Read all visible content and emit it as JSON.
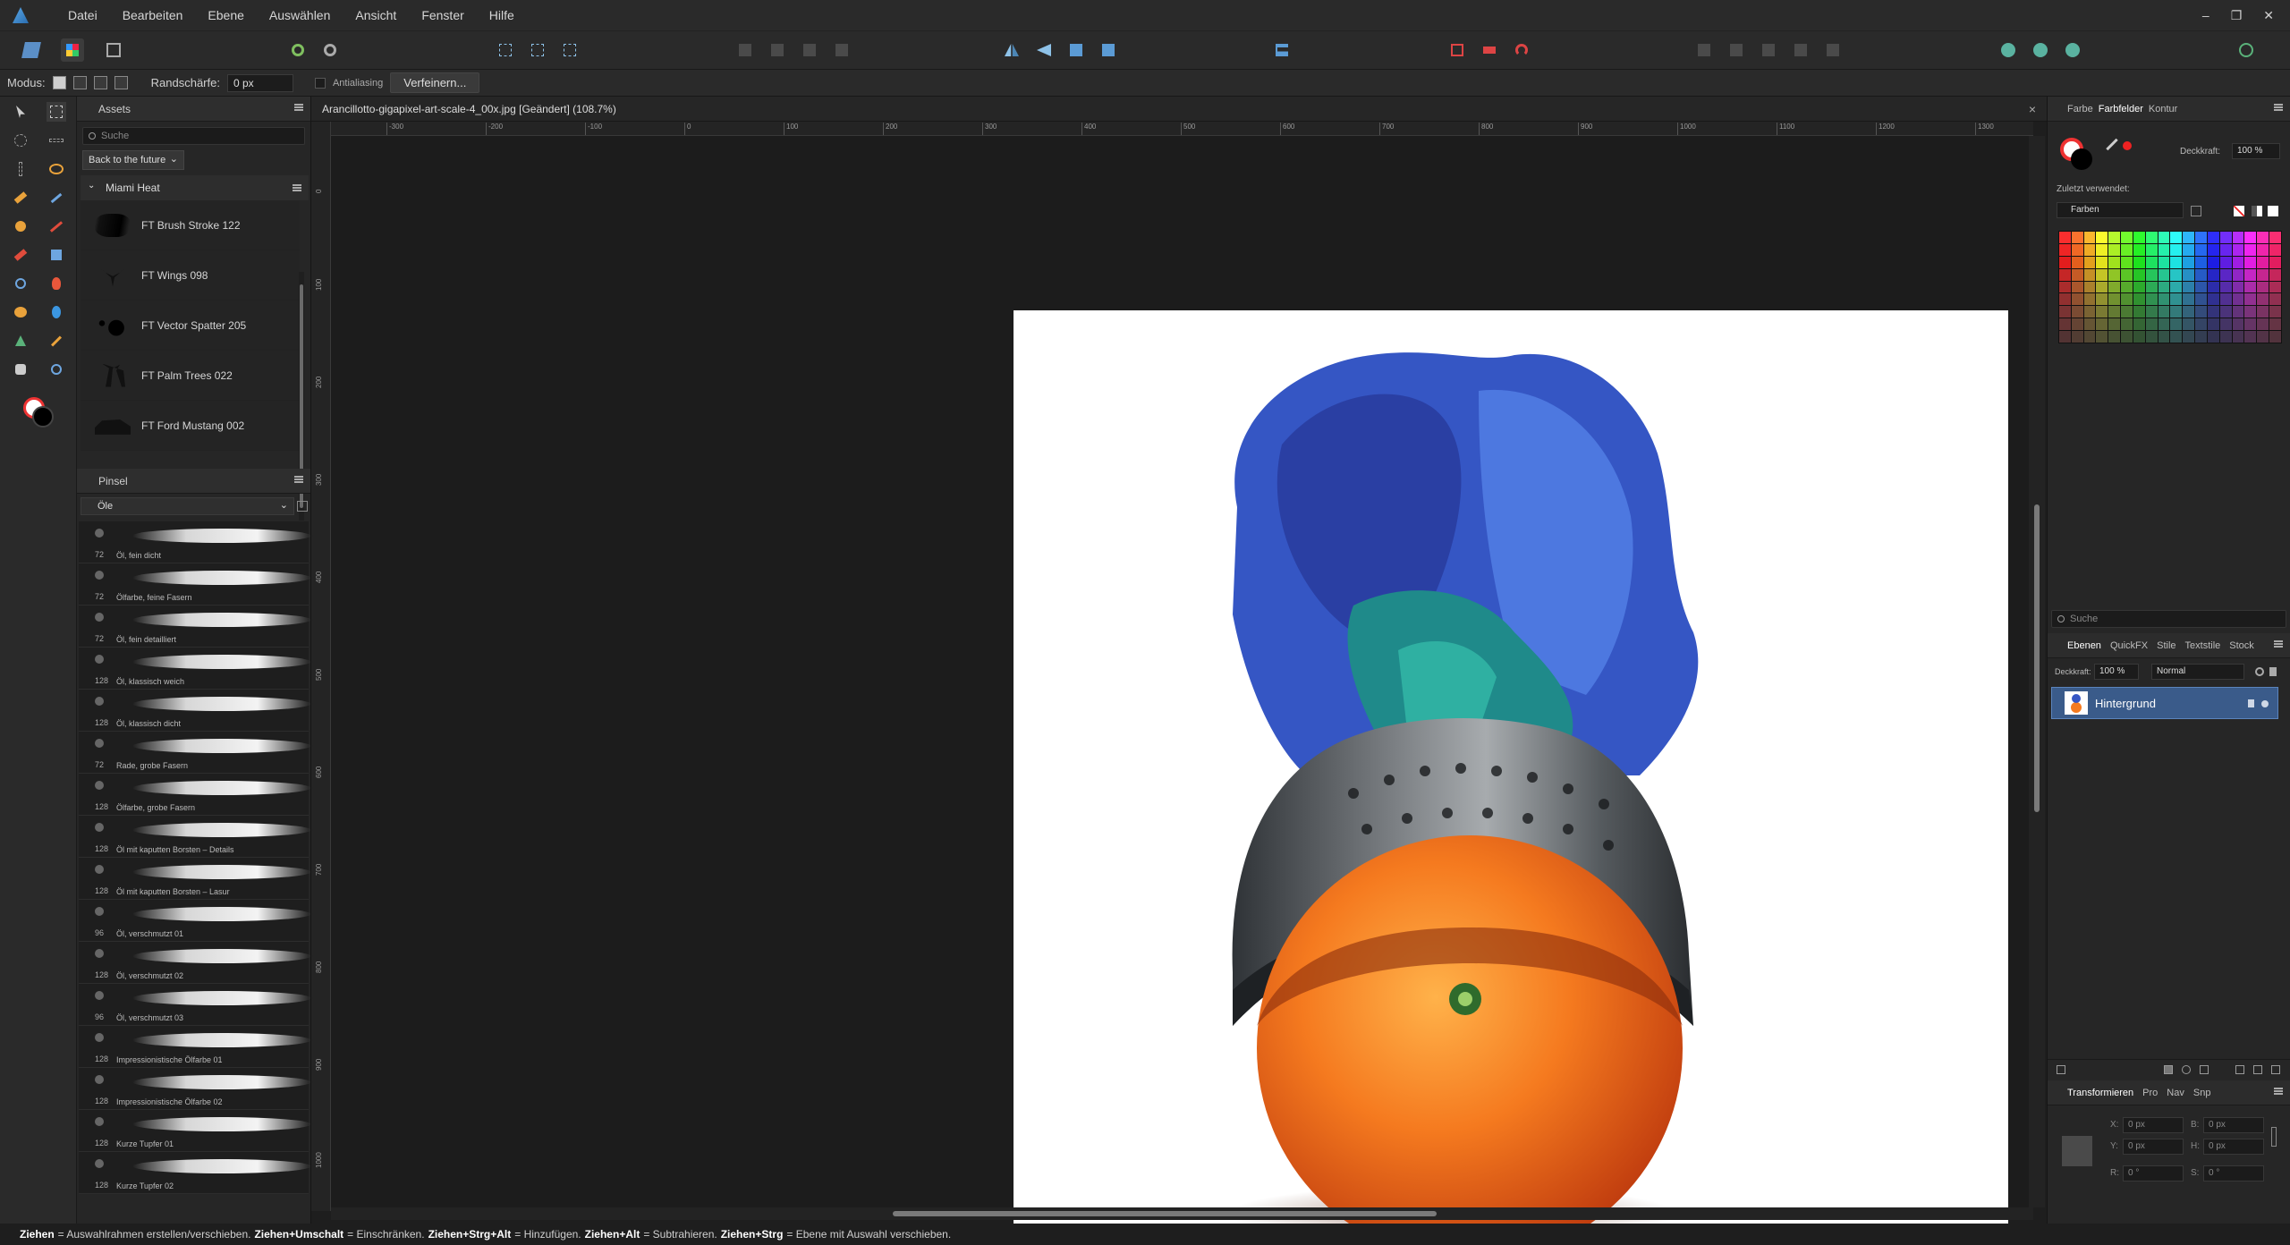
{
  "menu": {
    "items": [
      "Datei",
      "Bearbeiten",
      "Ebene",
      "Auswählen",
      "Ansicht",
      "Fenster",
      "Hilfe"
    ],
    "win_controls": [
      "–",
      "❐",
      "✕"
    ]
  },
  "context": {
    "mode_label": "Modus:",
    "feather_label": "Randschärfe:",
    "feather_value": "0 px",
    "antialias_label": "Antialiasing",
    "refine_button": "Verfeinern..."
  },
  "assets_panel": {
    "tab": "Assets",
    "search_placeholder": "Suche",
    "set_dropdown": "Back to the future",
    "category": "Miami Heat",
    "items": [
      {
        "name": "FT Brush Stroke 122"
      },
      {
        "name": "FT Wings 098"
      },
      {
        "name": "FT Vector Spatter 205"
      },
      {
        "name": "FT Palm Trees 022"
      },
      {
        "name": "FT Ford Mustang 002"
      }
    ]
  },
  "brush_panel": {
    "tab": "Pinsel",
    "category": "Öle",
    "brushes": [
      {
        "size": "72",
        "name": "Öl, fein dicht"
      },
      {
        "size": "72",
        "name": "Ölfarbe, feine Fasern"
      },
      {
        "size": "72",
        "name": "Öl, fein detailliert"
      },
      {
        "size": "128",
        "name": "Öl, klassisch weich"
      },
      {
        "size": "128",
        "name": "Öl, klassisch dicht"
      },
      {
        "size": "72",
        "name": "Rade, grobe Fasern"
      },
      {
        "size": "128",
        "name": "Ölfarbe, grobe Fasern"
      },
      {
        "size": "128",
        "name": "Öl mit kaputten Borsten – Details"
      },
      {
        "size": "128",
        "name": "Öl mit kaputten Borsten – Lasur"
      },
      {
        "size": "96",
        "name": "Öl, verschmutzt 01"
      },
      {
        "size": "128",
        "name": "Öl, verschmutzt 02"
      },
      {
        "size": "96",
        "name": "Öl, verschmutzt 03"
      },
      {
        "size": "128",
        "name": "Impressionistische Ölfarbe 01"
      },
      {
        "size": "128",
        "name": "Impressionistische Ölfarbe 02"
      },
      {
        "size": "128",
        "name": "Kurze Tupfer 01"
      },
      {
        "size": "128",
        "name": "Kurze Tupfer 02"
      }
    ]
  },
  "document": {
    "tab_title": "Arancillotto-gigapixel-art-scale-4_00x.jpg [Geändert] (108.7%)",
    "close": "×",
    "ruler_h_labels": [
      "-300",
      "-200",
      "-100",
      "0",
      "100",
      "200",
      "300",
      "400",
      "500",
      "600",
      "700",
      "800",
      "900",
      "1000",
      "1100",
      "1200",
      "1300"
    ],
    "ruler_v_labels": [
      "0",
      "100",
      "200",
      "300",
      "400",
      "500",
      "600",
      "700",
      "800",
      "900",
      "1000"
    ]
  },
  "colour_panel": {
    "tabs": [
      "Farbe",
      "Farbfelder",
      "Kontur"
    ],
    "opacity_label": "Deckkraft:",
    "opacity_value": "100 %",
    "recent_label": "Zuletzt verwendet:",
    "palette_dropdown": "Farben"
  },
  "layers_panel": {
    "search_placeholder": "Suche",
    "tabs": [
      "Ebenen",
      "QuickFX",
      "Stile",
      "Textstile",
      "Stock"
    ],
    "opacity_label": "Deckkraft:",
    "opacity_value": "100 %",
    "blend_mode": "Normal",
    "layer_name": "Hintergrund"
  },
  "transform_panel": {
    "tabs": [
      "Transformieren",
      "Pro",
      "Nav",
      "Snp"
    ],
    "x_label": "X:",
    "x_value": "0 px",
    "y_label": "Y:",
    "y_value": "0 px",
    "b_label": "B:",
    "b_value": "0 px",
    "h_label": "H:",
    "h_value": "0 px",
    "r_label": "R:",
    "r_value": "0 °",
    "s_label": "S:",
    "s_value": "0 °"
  },
  "status": {
    "parts": [
      {
        "key": "Ziehen",
        "text": "= Auswahlrahmen erstellen/verschieben."
      },
      {
        "key": "Ziehen+Umschalt",
        "text": "= Einschränken."
      },
      {
        "key": "Ziehen+Strg+Alt",
        "text": "= Hinzufügen."
      },
      {
        "key": "Ziehen+Alt",
        "text": "= Subtrahieren."
      },
      {
        "key": "Ziehen+Strg",
        "text": "= Ebene mit Auswahl verschieben."
      }
    ]
  },
  "colors": {
    "accent": "#3a5b8a",
    "orange": "#f0701e",
    "feather_blue": "#3f5ec9",
    "helmet": "#5a5f63"
  }
}
